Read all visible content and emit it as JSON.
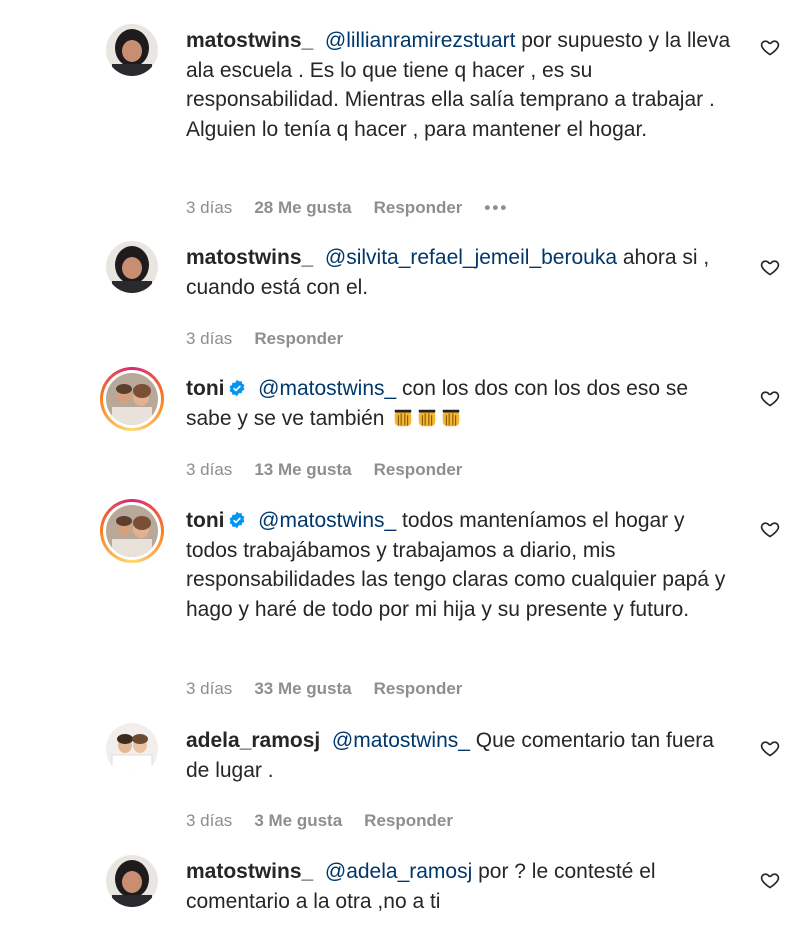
{
  "comments": [
    {
      "username": "matostwins_",
      "mention": "@lillianramirezstuart",
      "text": " por supuesto y la lleva ala escuela . Es lo que tiene q hacer , es su responsabilidad. Mientras ella salía temprano a trabajar . Alguien lo tenía q hacer , para mantener el hogar.",
      "time": "3 días",
      "likes": "28 Me gusta",
      "reply": "Responder",
      "more": "•••"
    },
    {
      "username": "matostwins_",
      "mention": "@silvita_refael_jemeil_berouka",
      "text": " ahora si , cuando está con el.",
      "time": "3 días",
      "reply": "Responder"
    },
    {
      "username": "toni",
      "verified": true,
      "mention": "@matostwins_",
      "text": " con los dos con los dos eso se sabe y se ve también",
      "emoji_icons": [
        "praising-hands-emoji",
        "praising-hands-emoji",
        "praising-hands-emoji"
      ],
      "time": "3 días",
      "likes": "13 Me gusta",
      "reply": "Responder"
    },
    {
      "username": "toni",
      "verified": true,
      "mention": "@matostwins_",
      "text": " todos manteníamos el hogar y todos trabajábamos y trabajamos a diario, mis responsabilidades las tengo claras como cualquier papá y hago y haré de todo por mi hija y su presente y futuro.",
      "time": "3 días",
      "likes": "33 Me gusta",
      "reply": "Responder"
    },
    {
      "username": "adela_ramosj",
      "mention": "@matostwins_",
      "text": " Que comentario tan fuera de lugar .",
      "time": "3 días",
      "likes": "3 Me gusta",
      "reply": "Responder"
    },
    {
      "username": "matostwins_",
      "mention": "@adela_ramosj",
      "text": " por ? le contesté el comentario a la otra ,no a ti"
    }
  ],
  "colors": {
    "text": "#262626",
    "mention": "#00376b",
    "meta": "#8e8e8e",
    "verified": "#0095f6"
  }
}
